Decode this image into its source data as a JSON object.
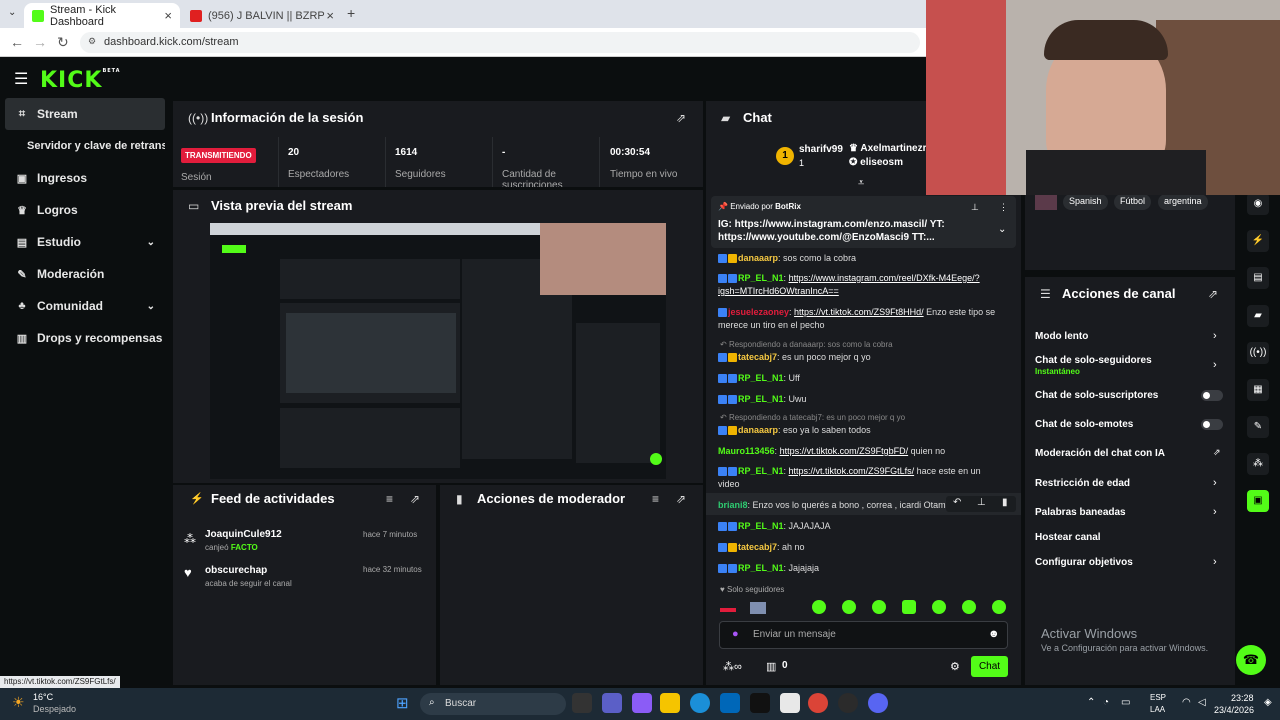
{
  "browser": {
    "tabs": [
      {
        "label": "Stream - Kick Dashboard",
        "active": true
      },
      {
        "label": "(956) J BALVIN || BZRP Music Se",
        "active": false
      }
    ],
    "url": "dashboard.kick.com/stream"
  },
  "kick": {
    "logo": "KICK",
    "logo_tag": "BETA"
  },
  "sidebar": {
    "items": [
      {
        "label": "Stream",
        "icon": "broadcast-icon"
      },
      {
        "label": "Servidor y clave de retransm",
        "icon": ""
      },
      {
        "label": "Ingresos",
        "icon": "money-icon"
      },
      {
        "label": "Logros",
        "icon": "trophy-icon"
      },
      {
        "label": "Estudio",
        "icon": "studio-icon"
      },
      {
        "label": "Moderación",
        "icon": "wrench-icon"
      },
      {
        "label": "Comunidad",
        "icon": "community-icon"
      },
      {
        "label": "Drops y recompensas",
        "icon": "gift-icon"
      }
    ]
  },
  "session": {
    "title": "Información de la sesión",
    "live_badge": "TRANSMITIENDO",
    "session_label": "Sesión",
    "stats": [
      {
        "value": "20",
        "label": "Espectadores"
      },
      {
        "value": "1614",
        "label": "Seguidores"
      },
      {
        "value": "-",
        "label": "Cantidad de suscripciones"
      },
      {
        "value": "00:30:54",
        "label": "Tiempo en vivo"
      }
    ]
  },
  "preview": {
    "title": "Vista previa del stream"
  },
  "feed": {
    "title": "Feed de actividades",
    "items": [
      {
        "user": "JoaquinCule912",
        "action": "canjeó",
        "highlight": "FACTO",
        "time": "hace 7 minutos"
      },
      {
        "user": "obscurechap",
        "action": "acaba de seguir el canal",
        "highlight": "",
        "time": "hace 32 minutos"
      }
    ]
  },
  "modactions": {
    "title": "Acciones de moderador"
  },
  "chat": {
    "title": "Chat",
    "top_gifter": {
      "rank": "1",
      "user": "sharifv99",
      "count": "1"
    },
    "users": [
      "Axelmartinezr",
      "eliseosm"
    ],
    "pinned": {
      "by_label": "Enviado por",
      "by_user": "BotRix",
      "text_prefix": "IG: ",
      "link1": "https://www.instagram.com/enzo.mascil/",
      "mid": " YT: ",
      "link2": "https://www.youtube.com/@EnzoMasci9",
      "suffix": " TT:..."
    },
    "messages": [
      {
        "user": "danaaarp",
        "text": ": sos como la cobra",
        "link": ""
      },
      {
        "user": "RP_EL_N1",
        "text": ":",
        "link": "https://www.instagram.com/reel/DXfk-M4Eege/?igsh=MTIrcHd6OWtranIncA=="
      },
      {
        "user": "jesuelezaoney",
        "text": " Enzo este tipo se merece un tiro en el pecho",
        "link": "https://vt.tiktok.com/ZS9Ft8HHd/"
      },
      {
        "reply": "Respondiendo a danaaarp: sos como la cobra"
      },
      {
        "user": "tatecabj7",
        "text": ": es un poco mejor q yo",
        "link": ""
      },
      {
        "user": "RP_EL_N1",
        "text": ": Uff",
        "link": ""
      },
      {
        "user": "RP_EL_N1",
        "text": ": Uwu",
        "link": ""
      },
      {
        "reply": "Respondiendo a tatecabj7: es un poco mejor q yo"
      },
      {
        "user": "danaaarp",
        "text": ": eso ya lo saben todos",
        "link": ""
      },
      {
        "user": "Mauro113456",
        "text": " quien no",
        "link": "https://vt.tiktok.com/ZS9FtgbFD/"
      },
      {
        "user": "RP_EL_N1",
        "text": " hace este en un video",
        "link": "https://vt.tiktok.com/ZS9FGtLfs/"
      },
      {
        "user": "briani8",
        "text": ": Enzo vos lo querés a bono , correa , icardi Otamendi",
        "link": ""
      },
      {
        "user": "RP_EL_N1",
        "text": ": JAJAJAJA",
        "link": ""
      },
      {
        "user": "tatecabj7",
        "text": ": ah no",
        "link": ""
      },
      {
        "user": "RP_EL_N1",
        "text": ": Jajajaja",
        "link": ""
      }
    ],
    "followers_only": "Solo seguidores",
    "input_placeholder": "Enviar un mensaje",
    "points": "0",
    "send_label": "Chat"
  },
  "channel": {
    "tags": [
      "Spanish",
      "Fútbol",
      "argentina"
    ],
    "title": "Acciones de canal",
    "options": [
      {
        "label": "Modo lento",
        "sub": "",
        "kind": "arrow"
      },
      {
        "label": "Chat de solo-seguidores",
        "sub": "Instantáneo",
        "kind": "arrow"
      },
      {
        "label": "Chat de solo-suscriptores",
        "sub": "",
        "kind": "toggle"
      },
      {
        "label": "Chat de solo-emotes",
        "sub": "",
        "kind": "toggle"
      },
      {
        "label": "Moderación del chat con IA",
        "sub": "",
        "kind": "external"
      },
      {
        "label": "Restricción de edad",
        "sub": "",
        "kind": "arrow"
      },
      {
        "label": "Palabras baneadas",
        "sub": "",
        "kind": "arrow"
      },
      {
        "label": "Hostear canal",
        "sub": "",
        "kind": "none"
      },
      {
        "label": "Configurar objetivos",
        "sub": "",
        "kind": "arrow"
      }
    ],
    "windows_title": "Activar Windows",
    "windows_sub": "Ve a Configuración para activar Windows."
  },
  "statusbar": {
    "url": "https://vt.tiktok.com/ZS9FGtLfs/"
  },
  "taskbar": {
    "temp": "16°C",
    "weather": "Despejado",
    "search": "Buscar",
    "lang": "ESP",
    "layout": "LAA",
    "time": "23:28",
    "date": "23/4/2026"
  },
  "colors": {
    "kick_green": "#53fc18",
    "live_red": "#e21d3c",
    "panel": "#191b1f"
  }
}
